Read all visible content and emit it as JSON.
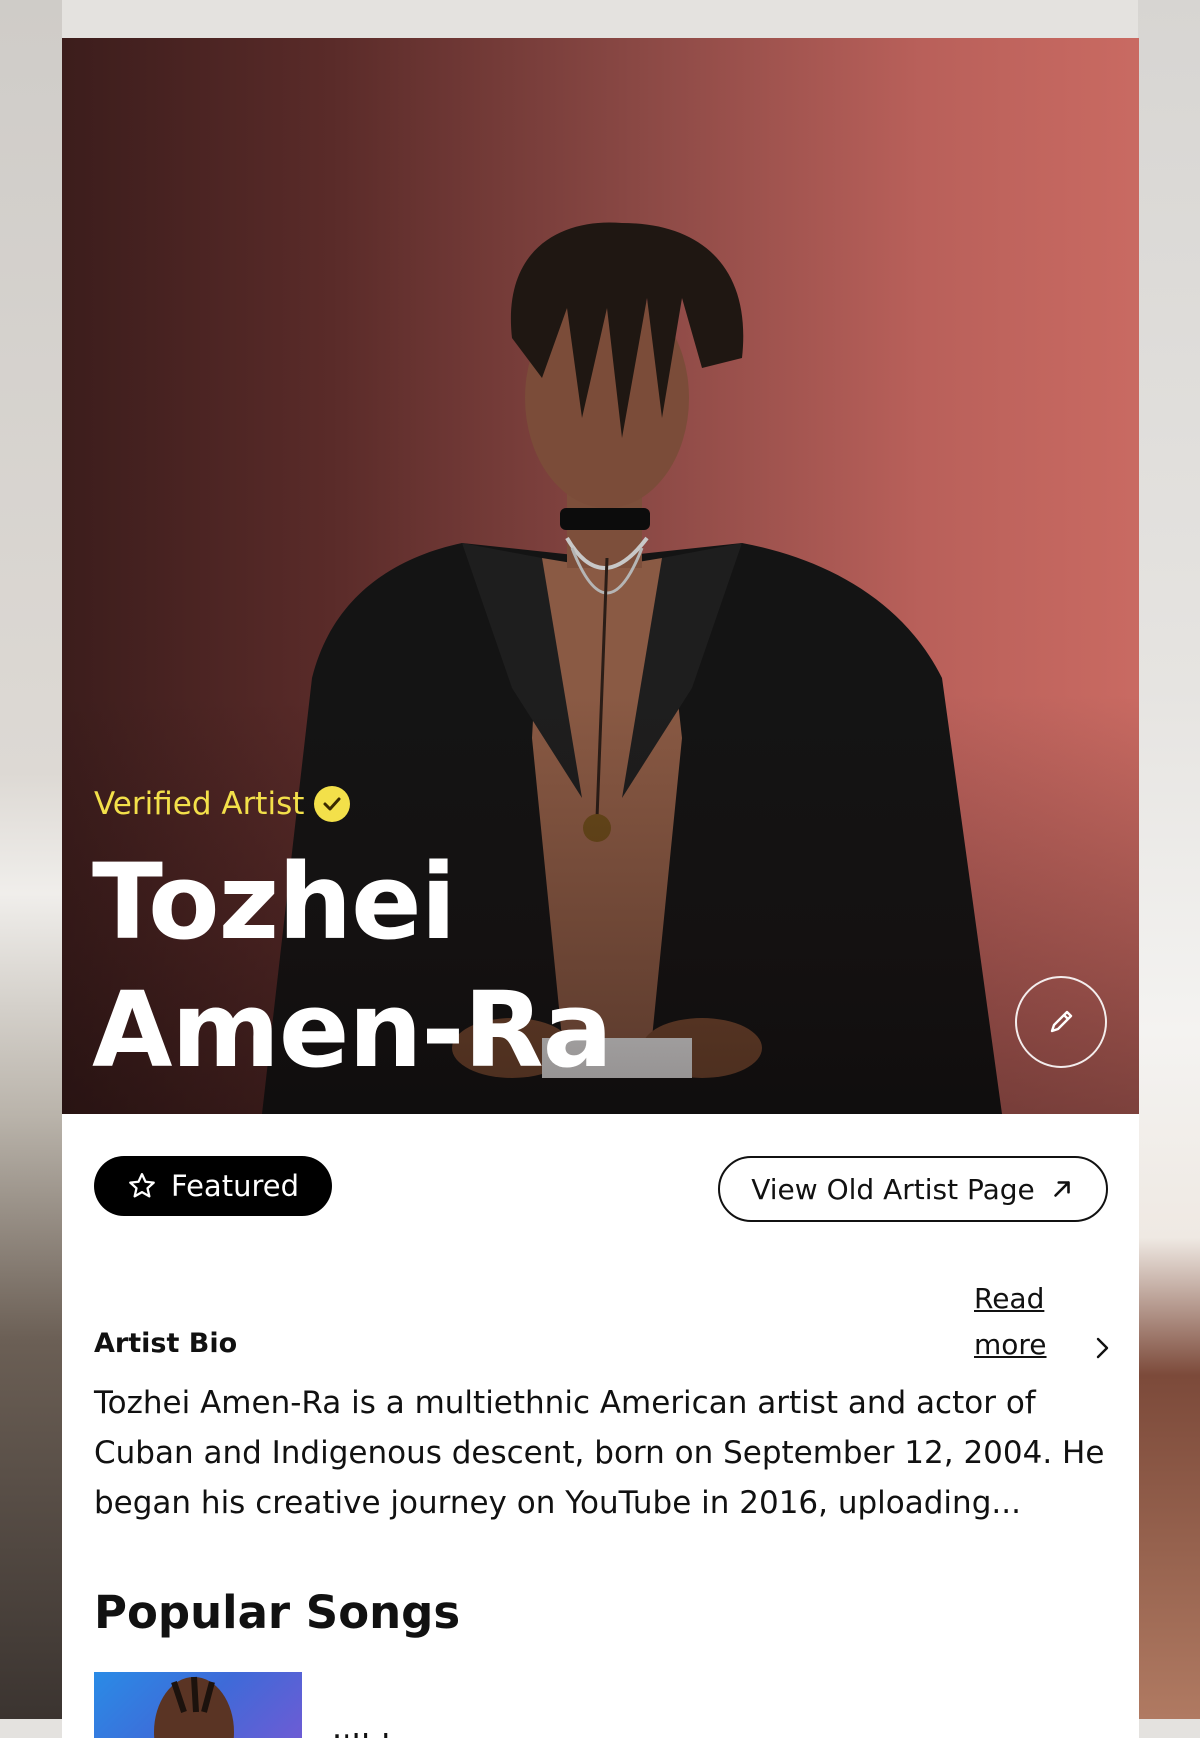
{
  "artist": {
    "verified_label": "Verified Artist",
    "name": "Tozhei Amen-Ra"
  },
  "actions": {
    "featured_label": "Featured",
    "old_page_label": "View Old Artist Page"
  },
  "bio": {
    "heading": "Artist Bio",
    "read_more": "Read more",
    "text": "Tozhei Amen-Ra is a multiethnic American artist and actor of Cuban and Indigenous descent, born on September 12, 2004. He began his creative journey on YouTube in 2016, uploading..."
  },
  "songs": {
    "heading": "Popular Songs",
    "items": [
      {
        "title": "I'll be over you"
      }
    ]
  },
  "colors": {
    "verified": "#f3e04a",
    "hero_dark": "#3c1d1c",
    "hero_light": "#c96a62"
  },
  "icons": [
    "verified-check-icon",
    "edit-pencil-icon",
    "star-icon",
    "external-arrow-icon",
    "chevron-right-icon"
  ]
}
